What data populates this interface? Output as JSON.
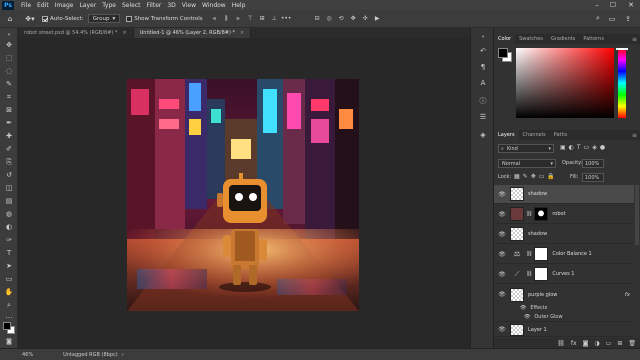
{
  "app": {
    "logo": "Ps",
    "menu": [
      "File",
      "Edit",
      "Image",
      "Layer",
      "Type",
      "Select",
      "Filter",
      "3D",
      "View",
      "Window",
      "Help"
    ],
    "window_controls": {
      "minimize": "–",
      "maximize": "☐",
      "close": "✕"
    }
  },
  "options_bar": {
    "auto_select_label": "Auto-Select:",
    "auto_select_checked": true,
    "auto_select_target": "Group",
    "show_transform_label": "Show Transform Controls",
    "show_transform_checked": false,
    "more": "•••"
  },
  "documents": {
    "tabs": [
      {
        "title": "robot street.psd @ 54.4% (RGB/8#) *",
        "active": false
      },
      {
        "title": "Untitled-1 @ 46% (Layer 2, RGB/8#) *",
        "active": true
      }
    ],
    "close_glyph": "×"
  },
  "toolbar": {
    "tools": [
      "move-tool",
      "marquee-tool",
      "lasso-tool",
      "quick-select-tool",
      "crop-tool",
      "frame-tool",
      "eyedropper-tool",
      "healing-brush-tool",
      "brush-tool",
      "clone-stamp-tool",
      "history-brush-tool",
      "eraser-tool",
      "gradient-tool",
      "blur-tool",
      "dodge-tool",
      "pen-tool",
      "type-tool",
      "path-select-tool",
      "rectangle-tool",
      "hand-tool",
      "zoom-tool",
      "more-tools"
    ],
    "glyphs": [
      "✥",
      "⬚",
      "◌",
      "✎",
      "⌗",
      "⊠",
      "✒",
      "✚",
      "✐",
      "⎘",
      "↺",
      "◫",
      "▤",
      "◍",
      "◐",
      "✑",
      "T",
      "➤",
      "▭",
      "✋",
      "⌕",
      "…"
    ]
  },
  "color_panel": {
    "tabs": [
      "Color",
      "Swatches",
      "Gradients",
      "Patterns"
    ],
    "active_tab": "Color",
    "hue_color": "#ff0000"
  },
  "layers_panel": {
    "tabs": [
      "Layers",
      "Channels",
      "Paths"
    ],
    "active_tab": "Layers",
    "filter_label": "Kind",
    "blend_mode": "Normal",
    "opacity_label": "Opacity:",
    "opacity_value": "100%",
    "lock_label": "Lock:",
    "fill_label": "Fill:",
    "fill_value": "100%",
    "layers": [
      {
        "name": "shadow",
        "type": "pixel",
        "selected": true,
        "has_mask": false
      },
      {
        "name": "robot",
        "type": "pixel",
        "selected": false,
        "has_mask": true
      },
      {
        "name": "shadow",
        "type": "pixel",
        "selected": false,
        "has_mask": false
      },
      {
        "name": "Color Balance 1",
        "type": "adjustment",
        "selected": false,
        "has_mask": true
      },
      {
        "name": "Curves 1",
        "type": "adjustment",
        "selected": false,
        "has_mask": true
      },
      {
        "name": "purple glow",
        "type": "pixel",
        "selected": false,
        "has_mask": false,
        "fx": "fx"
      },
      {
        "name": "Layer 1",
        "type": "pixel",
        "selected": false,
        "has_mask": false
      }
    ],
    "effects_label": "Effects",
    "effect_name": "Outer Glow",
    "bottom_icons": [
      "link-icon",
      "fx-icon",
      "mask-icon",
      "adjustment-icon",
      "group-icon",
      "new-layer-icon",
      "trash-icon"
    ],
    "bottom_glyphs": [
      "⛓",
      "fx",
      "◙",
      "◑",
      "▭",
      "⊞",
      "🗑"
    ]
  },
  "dock_icons": {
    "names": [
      "history-icon",
      "paragraph-icon",
      "character-icon",
      "info-icon",
      "properties-icon",
      "libraries-icon"
    ],
    "glyphs": [
      "↶",
      "¶",
      "A",
      "ⓘ",
      "☰",
      "◈"
    ]
  },
  "status_bar": {
    "zoom": "46%",
    "doc_info": "Untagged RGB (8bpc)"
  },
  "colors": {
    "foreground": "#000000",
    "background": "#ffffff",
    "accent": "#31a8ff"
  }
}
